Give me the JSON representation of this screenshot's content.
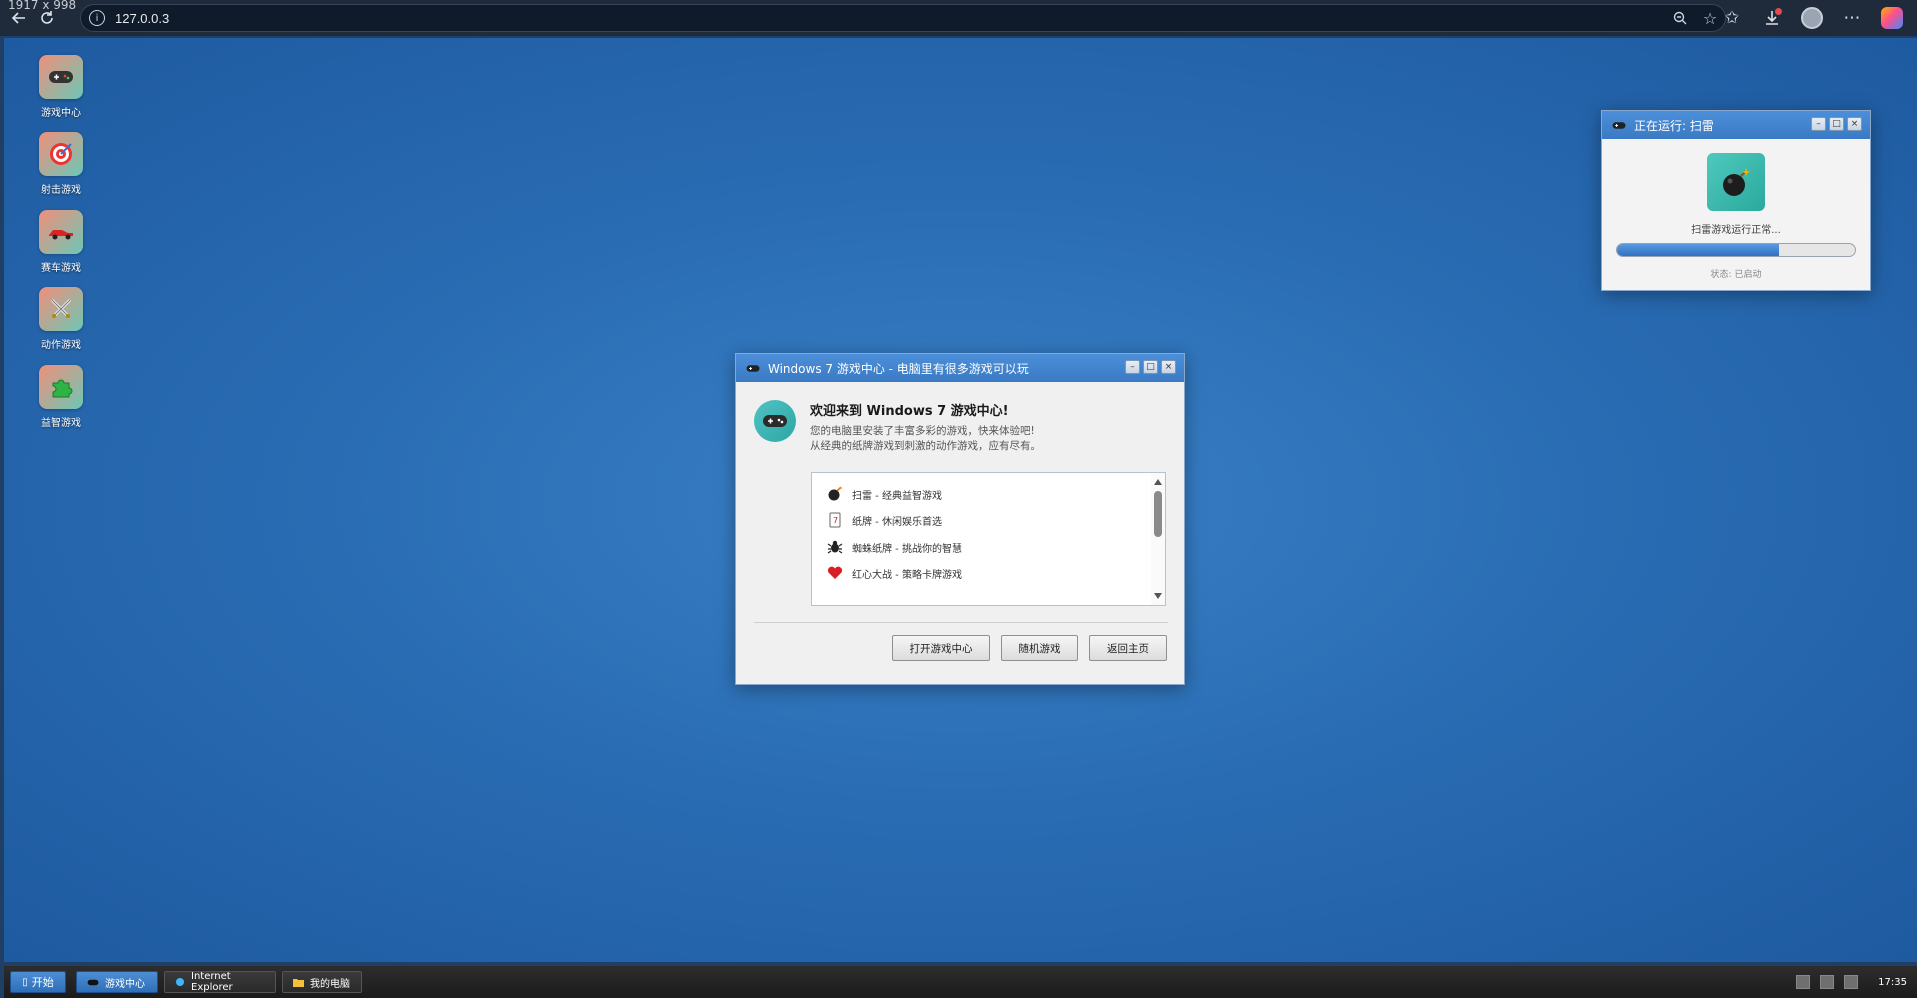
{
  "screen": {
    "dimensions_label": "1917 x 998"
  },
  "browser": {
    "url": "127.0.0.3"
  },
  "desktop_icons": [
    {
      "label": "游戏中心",
      "icon": "gamepad-icon"
    },
    {
      "label": "射击游戏",
      "icon": "target-icon"
    },
    {
      "label": "赛车游戏",
      "icon": "race-car-icon"
    },
    {
      "label": "动作游戏",
      "icon": "crossed-swords-icon"
    },
    {
      "label": "益智游戏",
      "icon": "puzzle-icon"
    }
  ],
  "dialog": {
    "title": "Windows 7 游戏中心 - 电脑里有很多游戏可以玩",
    "heading": "欢迎来到 Windows 7 游戏中心!",
    "desc_line1": "您的电脑里安装了丰富多彩的游戏，快来体验吧!",
    "desc_line2": "从经典的纸牌游戏到刺激的动作游戏，应有尽有。",
    "games": [
      {
        "label": "扫雷 - 经典益智游戏",
        "icon": "bomb-icon"
      },
      {
        "label": "纸牌 - 休闲娱乐首选",
        "icon": "playing-card-icon"
      },
      {
        "label": "蜘蛛纸牌 - 挑战你的智慧",
        "icon": "spider-icon"
      },
      {
        "label": "红心大战 - 策略卡牌游戏",
        "icon": "heart-icon"
      }
    ],
    "buttons": {
      "open": "打开游戏中心",
      "random": "随机游戏",
      "home": "返回主页"
    }
  },
  "running_window": {
    "title": "正在运行: 扫雷",
    "status": "扫雷游戏运行正常...",
    "progress_fraction": 0.68,
    "state": "状态: 已启动"
  },
  "taskbar": {
    "start": "开始",
    "tasks": [
      {
        "label": "游戏中心",
        "active": true
      },
      {
        "label": "Internet Explorer",
        "active": false
      },
      {
        "label": "我的电脑",
        "active": false
      }
    ],
    "clock": "17:35"
  }
}
